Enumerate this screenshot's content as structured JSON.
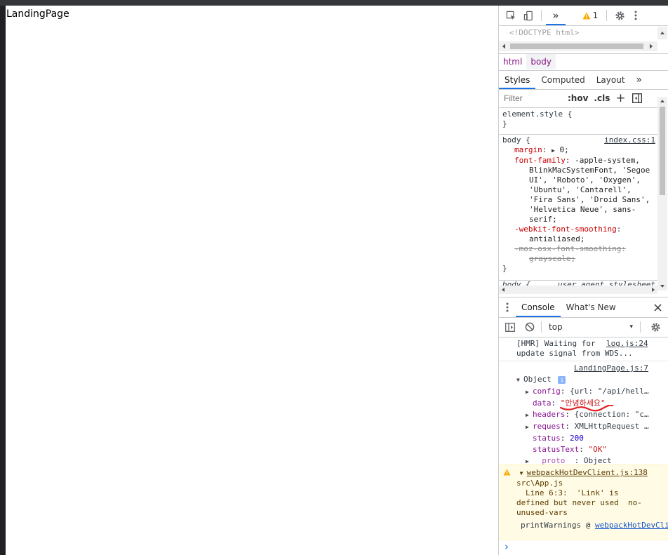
{
  "page": {
    "text": "LandingPage"
  },
  "devtools": {
    "toolbar": {
      "more_tabs": "»",
      "warning_count": "1"
    },
    "elements": {
      "doctype": "<!DOCTYPE html>"
    },
    "breadcrumbs": [
      "html",
      "body"
    ],
    "styles_tabs": [
      {
        "label": "Styles"
      },
      {
        "label": "Computed"
      },
      {
        "label": "Layout"
      },
      {
        "label": "»"
      }
    ],
    "filter": {
      "placeholder": "Filter",
      "hov": ":hov",
      "cls": ".cls",
      "plus": "+"
    },
    "element_style": {
      "selector": "element.style {",
      "close": "}"
    },
    "body_rule": {
      "selector": "body {",
      "source": "index.css:1",
      "margin_prop": "margin",
      "margin_val": "0;",
      "ff_prop": "font-family",
      "ff_val_lines": [
        "-apple-system,",
        "BlinkMacSystemFont, 'Segoe",
        "UI', 'Roboto', 'Oxygen',",
        "'Ubuntu', 'Cantarell',",
        "'Fira Sans', 'Droid Sans',",
        "'Helvetica Neue', sans-",
        "serif;"
      ],
      "wfs_prop": "-webkit-font-smoothing",
      "wfs_val": "antialiased;",
      "moz_prop": "-moz-osx-font-smoothing",
      "moz_val": "grayscale;",
      "close": "}"
    },
    "ua_rule": {
      "selector": "body {",
      "source": "user agent stylesheet"
    },
    "drawer_tabs": [
      {
        "label": "Console"
      },
      {
        "label": "What's New"
      }
    ],
    "console_toolbar": {
      "context": "top"
    },
    "console": {
      "hmr_line1": "[HMR] Waiting for",
      "hmr_line2": "update signal from WDS...",
      "hmr_source": "log.js:24",
      "log_source": "LandingPage.js:7",
      "object_label": "Object",
      "info_badge": "i",
      "config_key": "config",
      "config_val": "{url: \"/api/hell…",
      "data_key": "data",
      "data_val": "\"안녕하세요\"",
      "headers_key": "headers",
      "headers_val": "{connection: \"c…",
      "request_key": "request",
      "request_val": "XMLHttpRequest …",
      "status_key": "status",
      "status_val": "200",
      "statustext_key": "statusText",
      "statustext_val": "\"OK\"",
      "proto_key": "__proto__",
      "proto_val": "Object",
      "warn_source": "webpackHotDevClient.js:138",
      "warn_line1": "src\\App.js",
      "warn_line2": "Line 6:3:  'Link' is",
      "warn_line3": "defined but never used  no-",
      "warn_line4": "unused-vars",
      "warn_stack_fn": "printWarnings @",
      "warn_stack_link": "webpackHotDevClient.js",
      "prompt": "›"
    }
  }
}
